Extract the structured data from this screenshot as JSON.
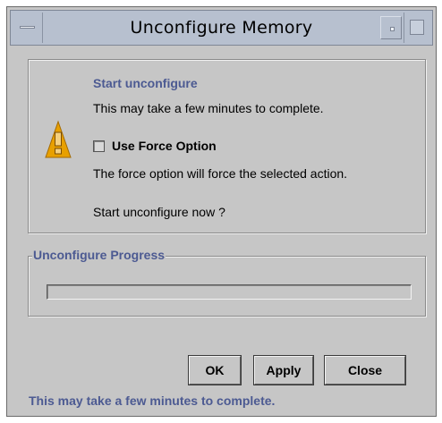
{
  "window": {
    "title": "Unconfigure Memory"
  },
  "message": {
    "heading": "Start unconfigure",
    "line1": "This may take a few minutes to complete.",
    "force_option_label": "Use Force Option",
    "force_option_checked": false,
    "force_description": "The force option will force the selected action.",
    "confirm_question": "Start unconfigure now ?",
    "icon": "warning-icon"
  },
  "progress": {
    "label": "Unconfigure Progress",
    "value_percent": 0
  },
  "buttons": {
    "ok": "OK",
    "apply": "Apply",
    "close": "Close"
  },
  "status": "This may take a few minutes to complete.",
  "colors": {
    "accent_text": "#4c5a92",
    "titlebar": "#b7c0cf",
    "background": "#c6c6c6",
    "warning": "#e8a000"
  }
}
